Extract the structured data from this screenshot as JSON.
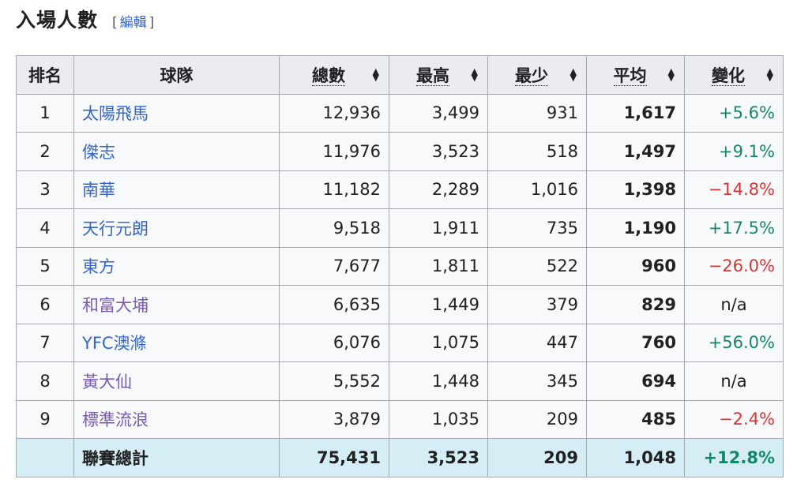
{
  "heading": {
    "title": "入場人數",
    "edit_open": "[",
    "edit_label": "編輯",
    "edit_close": "]"
  },
  "colors": {
    "link": "#3366cc",
    "visited": "#795cb2",
    "positive": "#14866d",
    "negative": "#d33",
    "total_bg": "#d5eef6"
  },
  "table": {
    "headers": {
      "rank": "排名",
      "team": "球隊",
      "total": "總數",
      "high": "最高",
      "low": "最少",
      "average": "平均",
      "change": "變化"
    },
    "sort_icon": "sort-arrows-icon",
    "rows": [
      {
        "rank": "1",
        "team": "太陽飛馬",
        "visited": false,
        "total": "12,936",
        "high": "3,499",
        "low": "931",
        "average": "1,617",
        "change": "+5.6%",
        "trend": "pos"
      },
      {
        "rank": "2",
        "team": "傑志",
        "visited": false,
        "total": "11,976",
        "high": "3,523",
        "low": "518",
        "average": "1,497",
        "change": "+9.1%",
        "trend": "pos"
      },
      {
        "rank": "3",
        "team": "南華",
        "visited": false,
        "total": "11,182",
        "high": "2,289",
        "low": "1,016",
        "average": "1,398",
        "change": "−14.8%",
        "trend": "neg"
      },
      {
        "rank": "4",
        "team": "天行元朗",
        "visited": false,
        "total": "9,518",
        "high": "1,911",
        "low": "735",
        "average": "1,190",
        "change": "+17.5%",
        "trend": "pos"
      },
      {
        "rank": "5",
        "team": "東方",
        "visited": false,
        "total": "7,677",
        "high": "1,811",
        "low": "522",
        "average": "960",
        "change": "−26.0%",
        "trend": "neg"
      },
      {
        "rank": "6",
        "team": "和富大埔",
        "visited": true,
        "total": "6,635",
        "high": "1,449",
        "low": "379",
        "average": "829",
        "change": "n/a",
        "trend": "na"
      },
      {
        "rank": "7",
        "team": "YFC澳滌",
        "visited": false,
        "total": "6,076",
        "high": "1,075",
        "low": "447",
        "average": "760",
        "change": "+56.0%",
        "trend": "pos"
      },
      {
        "rank": "8",
        "team": "黃大仙",
        "visited": true,
        "total": "5,552",
        "high": "1,448",
        "low": "345",
        "average": "694",
        "change": "n/a",
        "trend": "na"
      },
      {
        "rank": "9",
        "team": "標準流浪",
        "visited": true,
        "total": "3,879",
        "high": "1,035",
        "low": "209",
        "average": "485",
        "change": "−2.4%",
        "trend": "neg"
      }
    ],
    "total_row": {
      "rank": "",
      "team": "聯賽總計",
      "total": "75,431",
      "high": "3,523",
      "low": "209",
      "average": "1,048",
      "change": "+12.8%",
      "trend": "pos"
    }
  }
}
